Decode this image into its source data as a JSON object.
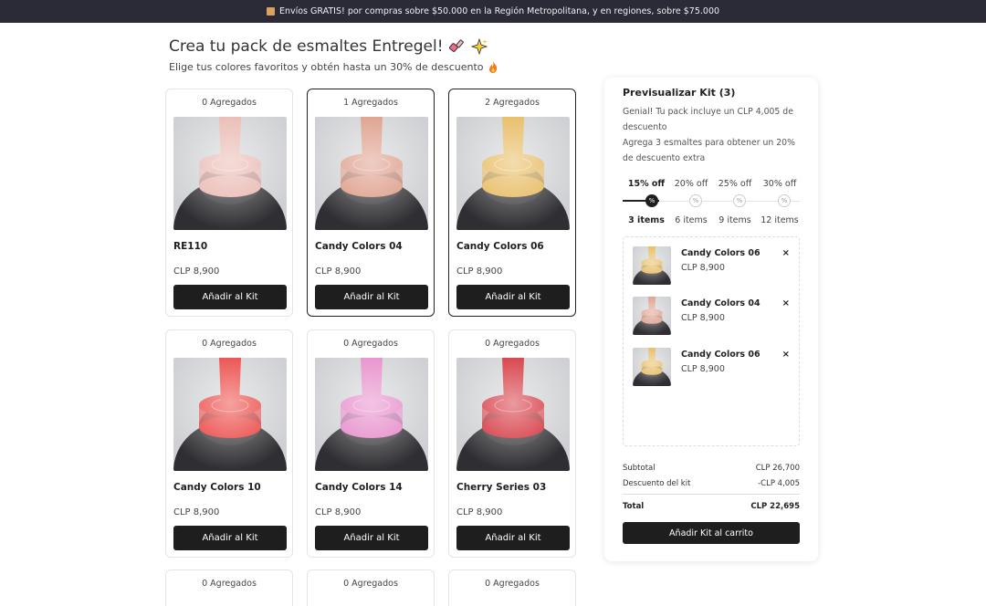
{
  "banner": {
    "text": "Envíos GRATIS! por compras sobre $50.000 en la Región Metropolitana, y en regiones, sobre $75.000"
  },
  "header": {
    "title": "Crea tu pack de esmaltes Entregel!",
    "subtitle": "Elige tus colores favoritos y obtén hasta un 30% de descuento"
  },
  "products": [
    {
      "added": "0 Agregados",
      "name": "RE110",
      "price": "CLP 8,900",
      "button": "Añadir al Kit",
      "color": "#e7b1a9"
    },
    {
      "added": "1 Agregados",
      "name": "Candy Colors 04",
      "price": "CLP 8,900",
      "button": "Añadir al Kit",
      "color": "#d9917b"
    },
    {
      "added": "2 Agregados",
      "name": "Candy Colors 06",
      "price": "CLP 8,900",
      "button": "Añadir al Kit",
      "color": "#e4b24c"
    },
    {
      "added": "0 Agregados",
      "name": "Candy Colors 10",
      "price": "CLP 8,900",
      "button": "Añadir al Kit",
      "color": "#e8322e"
    },
    {
      "added": "0 Agregados",
      "name": "Candy Colors 14",
      "price": "CLP 8,900",
      "button": "Añadir al Kit",
      "color": "#e37fc4"
    },
    {
      "added": "0 Agregados",
      "name": "Cherry Series 03",
      "price": "CLP 8,900",
      "button": "Añadir al Kit",
      "color": "#d0202a"
    },
    {
      "added": "0 Agregados"
    },
    {
      "added": "0 Agregados"
    },
    {
      "added": "0 Agregados"
    }
  ],
  "kit": {
    "title": "Previsualizar Kit (3)",
    "message": "Genial! Tu pack incluye un CLP 4,005 de descuento",
    "hint": "Agrega 3 esmaltes para obtener un 20% de descuento extra",
    "tiers": [
      {
        "pct": "15% off",
        "items": "3 items"
      },
      {
        "pct": "20% off",
        "items": "6 items"
      },
      {
        "pct": "25% off",
        "items": "9 items"
      },
      {
        "pct": "30% off",
        "items": "12 items"
      }
    ],
    "dot_symbol": "%",
    "progress_items": 3,
    "items": [
      {
        "name": "Candy Colors 06",
        "price": "CLP 8,900",
        "color": "#e4b24c"
      },
      {
        "name": "Candy Colors 04",
        "price": "CLP 8,900",
        "color": "#d9917b"
      },
      {
        "name": "Candy Colors 06",
        "price": "CLP 8,900",
        "color": "#e4b24c"
      }
    ],
    "remove_symbol": "×",
    "subtotal_label": "Subtotal",
    "subtotal_value": "CLP 26,700",
    "discount_label": "Descuento del kit",
    "discount_value": "-CLP 4,005",
    "total_label": "Total",
    "total_value": "CLP 22,695",
    "cart_button": "Añadir Kit al carrito"
  }
}
